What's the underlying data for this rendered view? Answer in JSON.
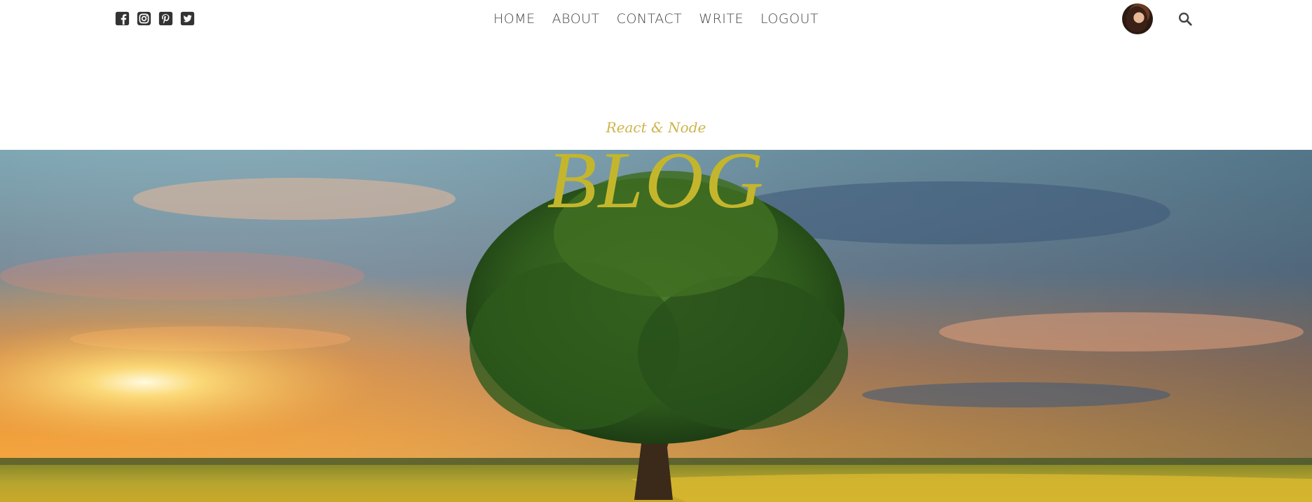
{
  "social": {
    "icons": [
      "facebook-icon",
      "instagram-icon",
      "pinterest-icon",
      "twitter-icon"
    ]
  },
  "nav": {
    "items": [
      "HOME",
      "ABOUT",
      "CONTACT",
      "WRITE",
      "LOGOUT"
    ]
  },
  "header": {
    "subtitle": "React & Node",
    "title": "BLOG"
  },
  "colors": {
    "title": "#c4b62c",
    "subtitle": "#cdb54a",
    "nav_text": "#444444",
    "icon": "#333333"
  }
}
